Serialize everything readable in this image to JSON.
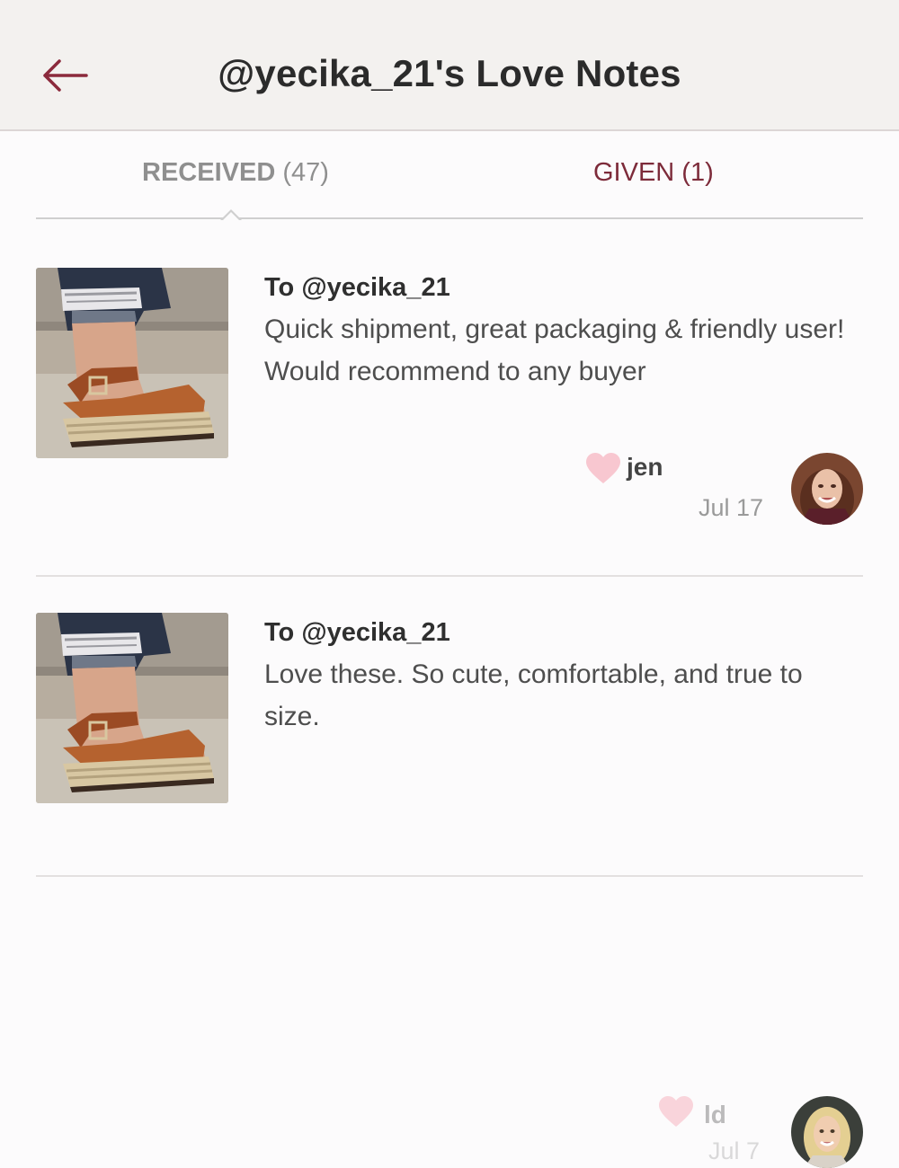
{
  "header": {
    "title": "@yecika_21's Love Notes",
    "back_icon": "arrow-left-icon",
    "accent_color": "#8b2a3c"
  },
  "tabs": {
    "received_label": "RECEIVED",
    "received_count": "(47)",
    "given_label": "GIVEN (1)",
    "selected": "received"
  },
  "notes": [
    {
      "to": "To @yecika_21",
      "text": "Quick shipment, great packaging & friendly user! Would recommend to any buyer",
      "sender": "jen",
      "date": "Jul 17",
      "image": "sandals-photo",
      "heart_color": "#f8c7d0"
    },
    {
      "to": "To @yecika_21",
      "text": "Love these. So cute, comfortable, and true to size.",
      "sender": "ld",
      "date": "Jul 7",
      "image": "sandals-photo",
      "heart_color": "#f8c7d0"
    }
  ]
}
